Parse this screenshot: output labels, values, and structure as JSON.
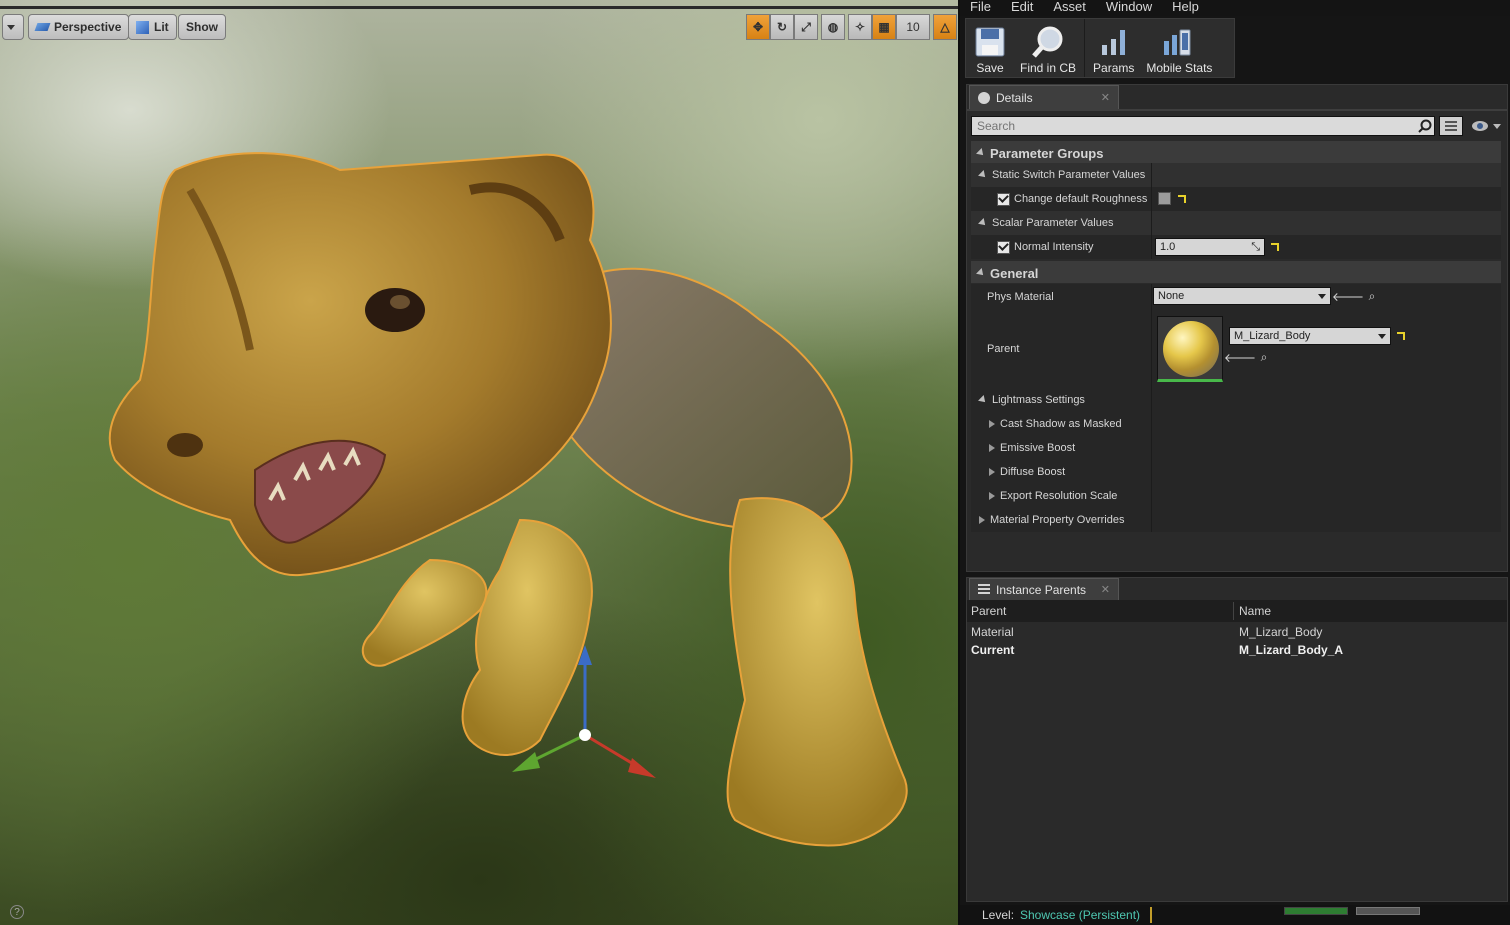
{
  "viewport": {
    "view_mode": "Perspective",
    "lighting": "Lit",
    "show": "Show",
    "grid_snap": "10"
  },
  "menu": [
    "File",
    "Edit",
    "Asset",
    "Window",
    "Help"
  ],
  "toolbar": [
    {
      "label": "Save",
      "icon": "save-icon"
    },
    {
      "label": "Find in CB",
      "icon": "magnifier-icon"
    },
    {
      "label": "Params",
      "icon": "params-icon"
    },
    {
      "label": "Mobile Stats",
      "icon": "mobile-stats-icon"
    }
  ],
  "details": {
    "tab": "Details",
    "search_placeholder": "Search",
    "groups": {
      "parameter_groups": "Parameter Groups",
      "static_switch": "Static Switch Parameter Values",
      "change_roughness": "Change default Roughness",
      "scalar": "Scalar Parameter Values",
      "normal_intensity": "Normal Intensity",
      "normal_intensity_value": "1.0",
      "general": "General",
      "phys_material": "Phys Material",
      "phys_material_value": "None",
      "parent": "Parent",
      "parent_value": "M_Lizard_Body",
      "lightmass": "Lightmass Settings",
      "cast_shadow": "Cast Shadow as Masked",
      "emissive": "Emissive Boost",
      "diffuse": "Diffuse Boost",
      "export_res": "Export Resolution Scale",
      "mat_overrides": "Material Property Overrides"
    }
  },
  "instance_parents": {
    "tab": "Instance Parents",
    "columns": [
      "Parent",
      "Name"
    ],
    "rows": [
      {
        "parent": "Material",
        "name": "M_Lizard_Body"
      },
      {
        "parent": "Current",
        "name": "M_Lizard_Body_A"
      }
    ]
  },
  "status": {
    "level_label": "Level:",
    "level_value": "Showcase (Persistent)"
  },
  "colors": {
    "accent": "#e09a2c",
    "selection_outline": "#e8a23a",
    "level": "#4ec7b1"
  }
}
